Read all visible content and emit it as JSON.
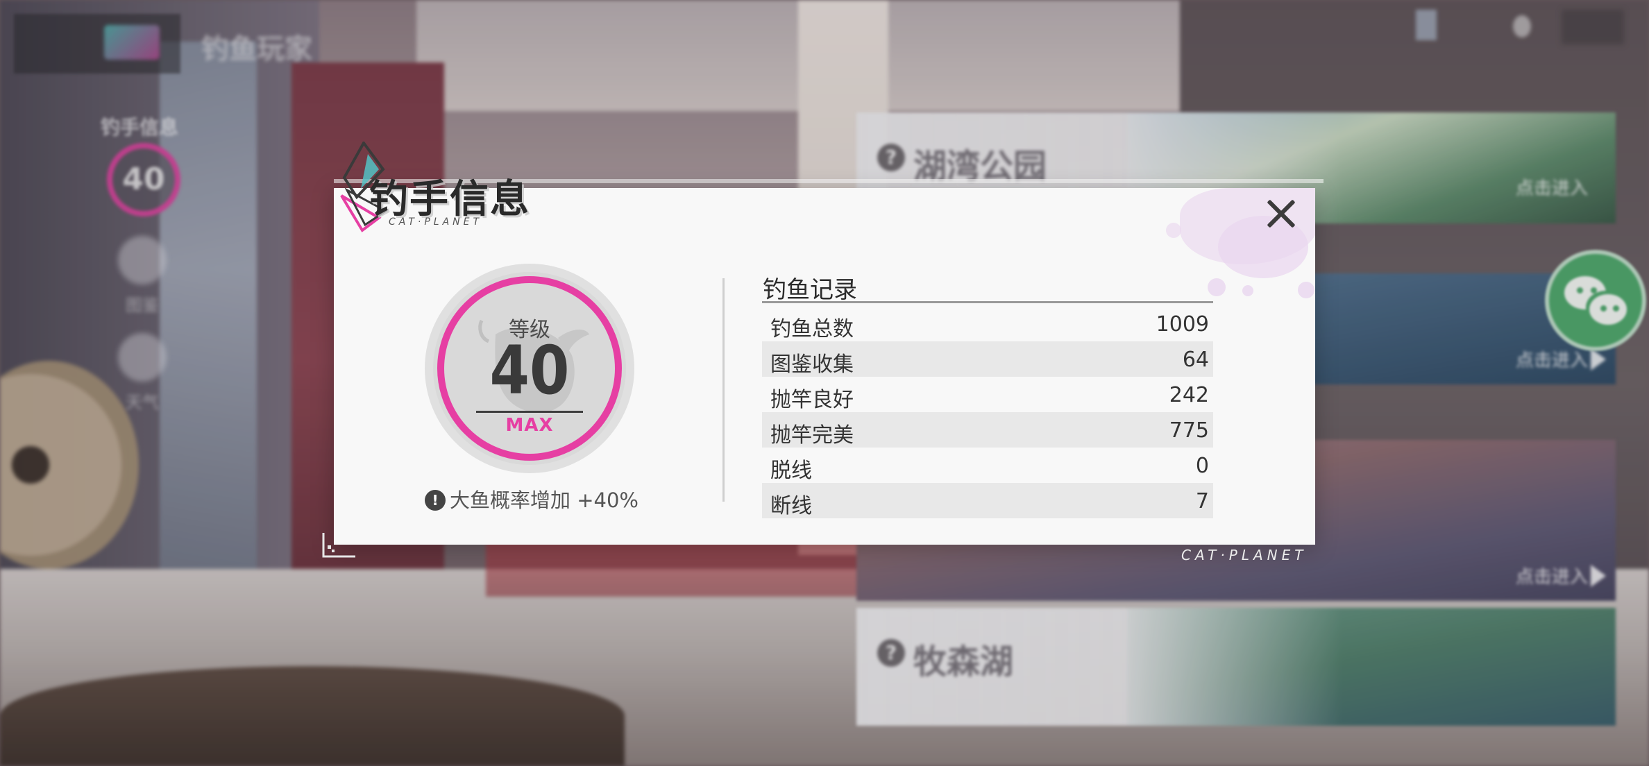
{
  "background": {
    "top_title": "钓鱼玩家",
    "side_label": "钓手信息",
    "side_level": "40",
    "side_icons": [
      {
        "icon": "globe-icon",
        "label": "图鉴"
      },
      {
        "icon": "cloud-icon",
        "label": "天气"
      }
    ],
    "locations": [
      {
        "name": "湖湾公园",
        "enter_label": "点击进入"
      },
      {
        "name": "",
        "enter_label": "点击进入"
      },
      {
        "name": "",
        "enter_label": "点击进入"
      },
      {
        "name": "牧森湖",
        "enter_label": ""
      }
    ],
    "share_icon": "wechat-icon"
  },
  "dialog": {
    "title": "钓手信息",
    "title_sub": "CAT·PLANET",
    "close_icon": "close-icon",
    "level": {
      "caption": "等级",
      "value": "40",
      "max_label": "MAX"
    },
    "bonus": {
      "icon": "info-icon",
      "icon_glyph": "!",
      "text": "大鱼概率增加 +40%"
    },
    "records": {
      "title": "钓鱼记录",
      "rows": [
        {
          "label": "钓鱼总数",
          "value": "1009"
        },
        {
          "label": "图鉴收集",
          "value": "64"
        },
        {
          "label": "抛竿良好",
          "value": "242"
        },
        {
          "label": "抛竿完美",
          "value": "775"
        },
        {
          "label": "脱线",
          "value": "0"
        },
        {
          "label": "断线",
          "value": "7"
        }
      ]
    },
    "footer_brand": "CAT·PLANET"
  },
  "colors": {
    "accent_pink": "#e63fa3",
    "dialog_bg": "#f8f8f8",
    "row_shade": "#e8e8e8"
  }
}
